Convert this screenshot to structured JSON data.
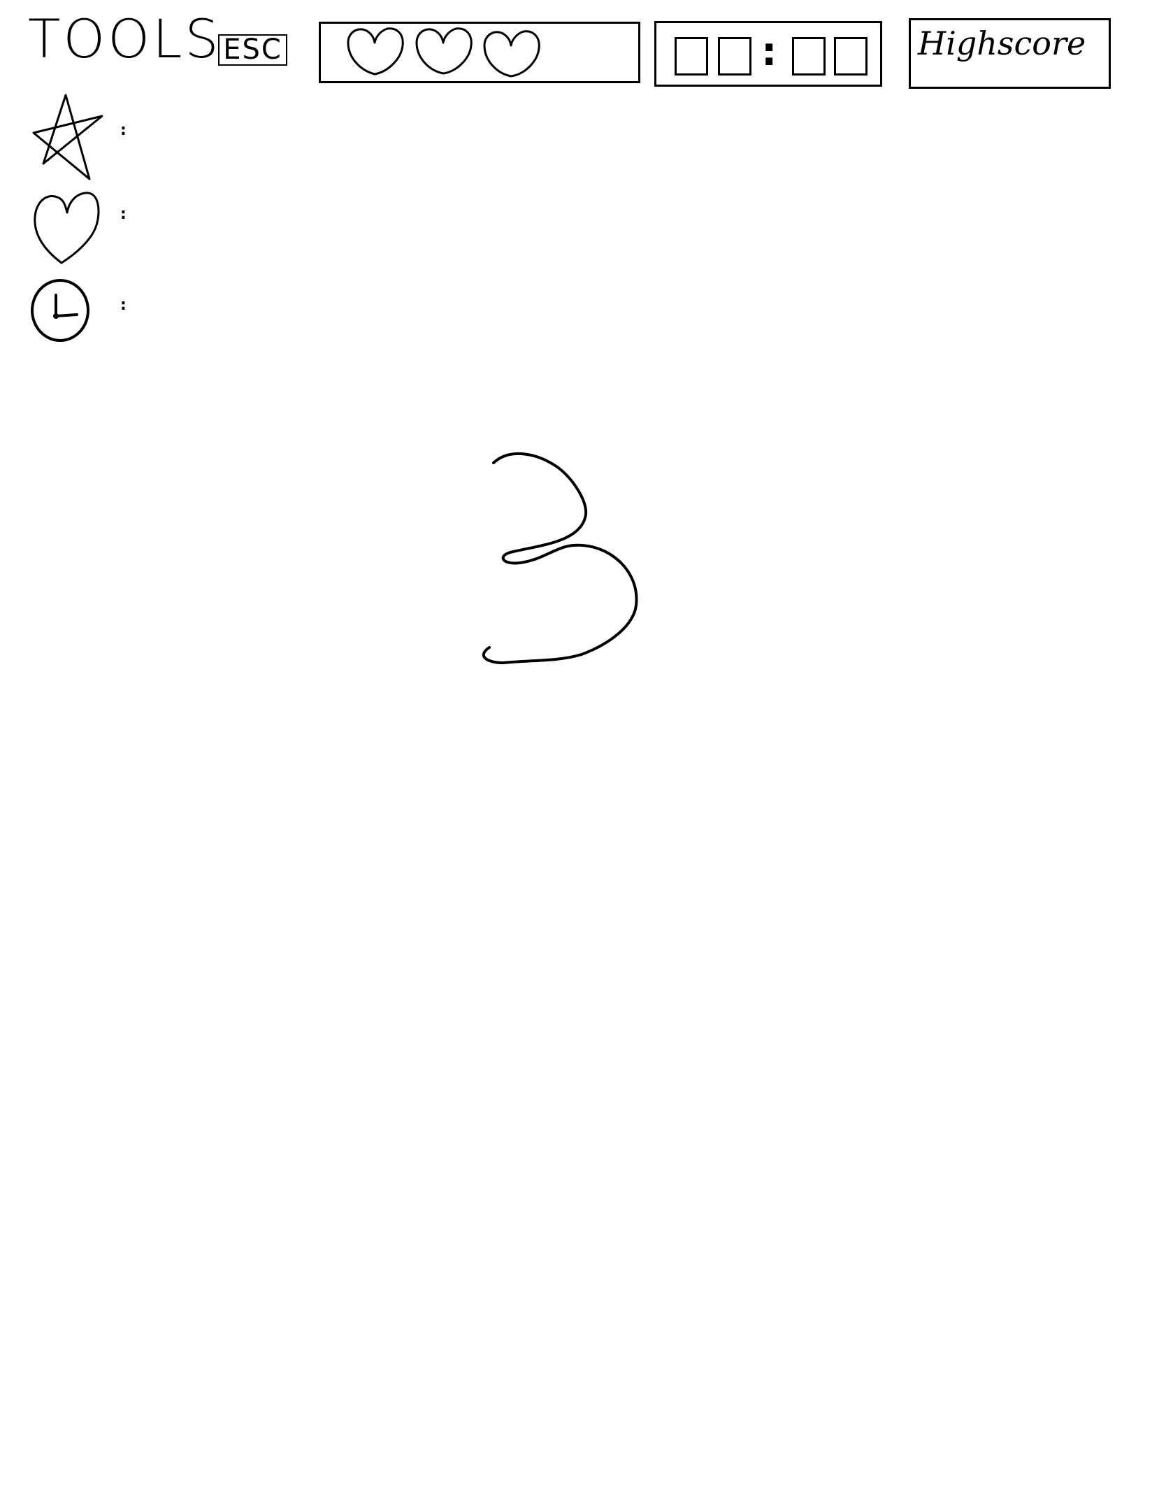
{
  "header": {
    "tools_title": "TOOLS",
    "esc_label": "ESC",
    "lives": {
      "count": 3,
      "icon": "heart-icon"
    },
    "timer": {
      "separator": ":",
      "minutes_slots": 2,
      "seconds_slots": 2
    },
    "highscore_label": "Highscore"
  },
  "sidebar": {
    "tools": [
      {
        "icon": "star-icon",
        "count_label": ":"
      },
      {
        "icon": "heart-icon",
        "count_label": ":"
      },
      {
        "icon": "clock-icon",
        "count_label": ":"
      }
    ]
  },
  "countdown": {
    "value": "3"
  },
  "colors": {
    "ink": "#000000",
    "background": "#ffffff"
  }
}
